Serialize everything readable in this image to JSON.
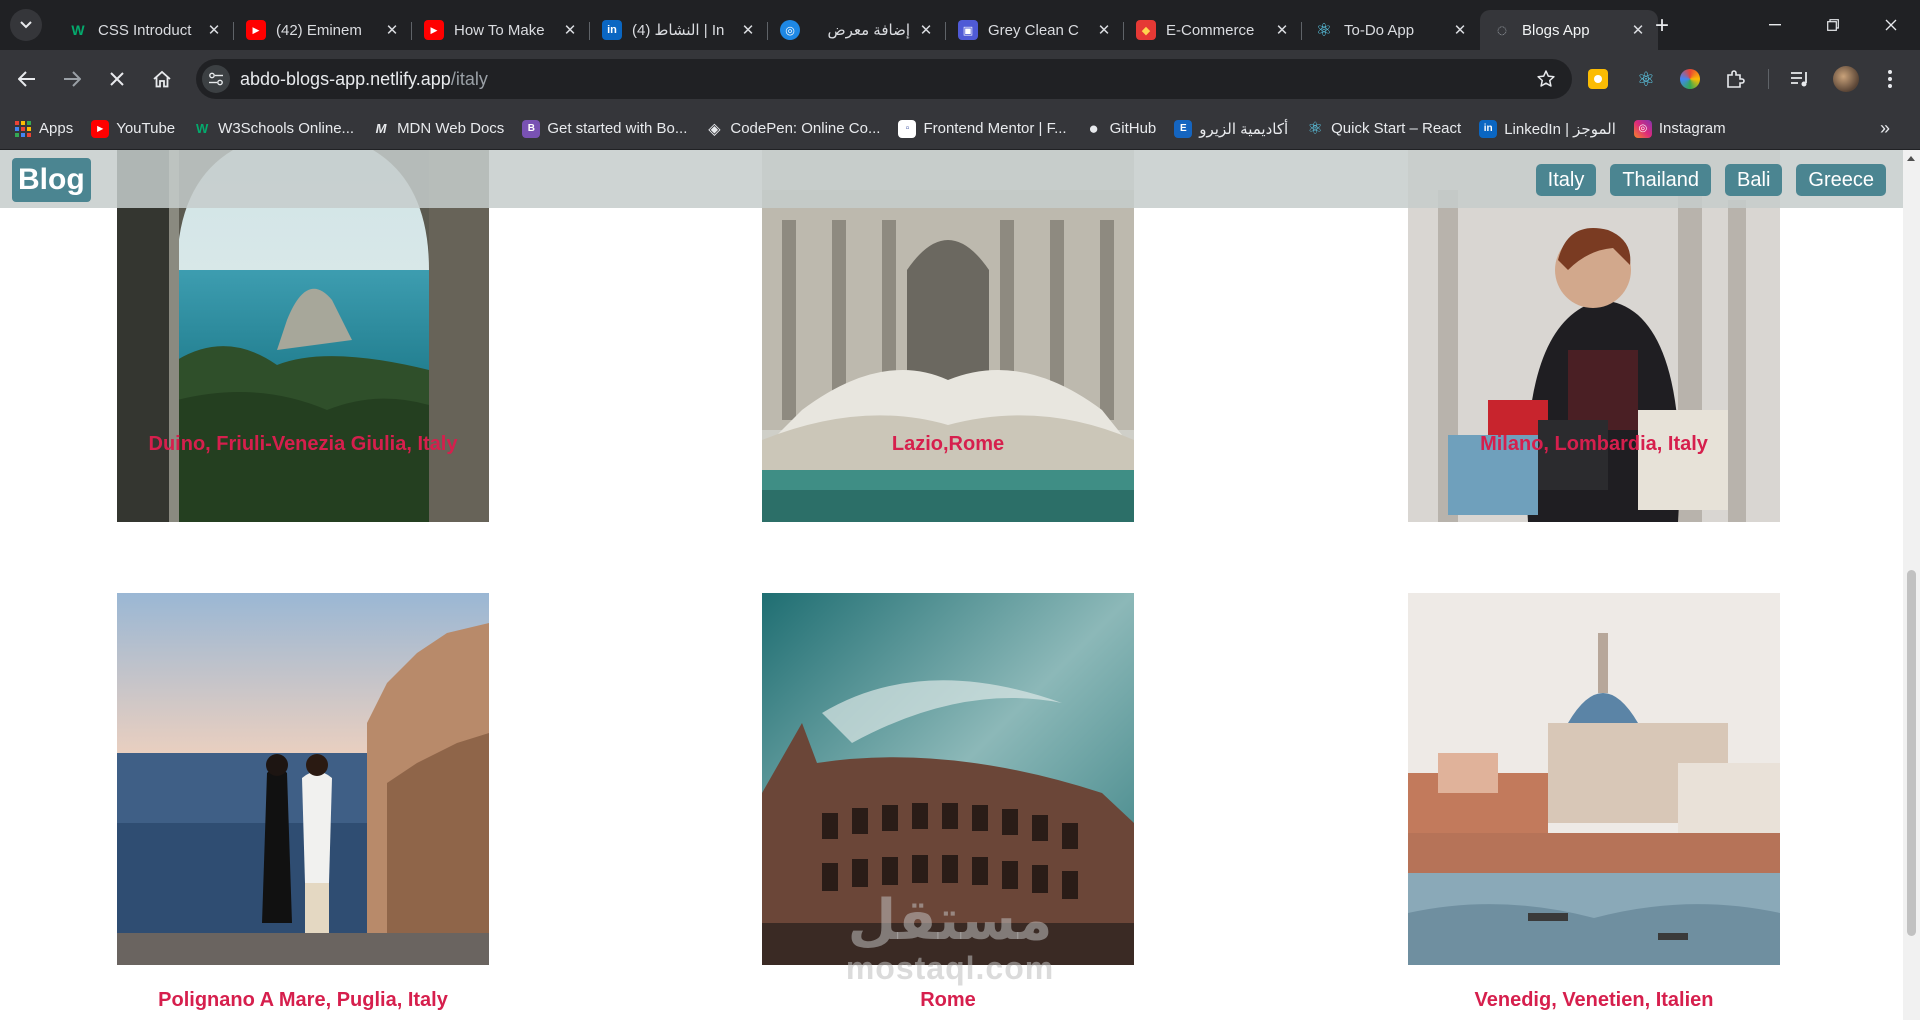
{
  "browser": {
    "tabs": [
      {
        "title": "CSS Introduct",
        "fav_text": "W",
        "fav_color": "#0f2027",
        "fav_fg": "#04aa6d"
      },
      {
        "title": "(42) Eminem",
        "fav_text": "▶",
        "fav_color": "#ff0000",
        "fav_fg": "#ffffff"
      },
      {
        "title": "How To Make",
        "fav_text": "▶",
        "fav_color": "#ff0000",
        "fav_fg": "#ffffff"
      },
      {
        "title": "(4) النشاط | In",
        "fav_text": "in",
        "fav_color": "#0a66c2",
        "fav_fg": "#ffffff"
      },
      {
        "title": "إضافة معرض",
        "fav_text": "◎",
        "fav_color": "#1e88e5",
        "fav_fg": "#ffffff"
      },
      {
        "title": "Grey Clean C",
        "fav_text": "▣",
        "fav_color": "#4f5ad6",
        "fav_fg": "#ffffff"
      },
      {
        "title": "E-Commerce",
        "fav_text": "◆",
        "fav_color": "#e53935",
        "fav_fg": "#ffd54f"
      },
      {
        "title": "To-Do App",
        "fav_text": "⚛",
        "fav_color": "transparent",
        "fav_fg": "#61dafb"
      },
      {
        "title": "Blogs App",
        "fav_text": "◌",
        "fav_color": "transparent",
        "fav_fg": "#9aa0a6"
      }
    ],
    "new_tab_symbol": "+",
    "url_domain": "abdo-blogs-app.netlify.app",
    "url_path": "/italy",
    "bookmarks": [
      {
        "label": "Apps",
        "fav_text": "⋮⋮",
        "fav_color": "transparent",
        "fav_fg": "#ea4335"
      },
      {
        "label": "YouTube",
        "fav_text": "▶",
        "fav_color": "#ff0000",
        "fav_fg": "#ffffff"
      },
      {
        "label": "W3Schools Online...",
        "fav_text": "W",
        "fav_color": "transparent",
        "fav_fg": "#04aa6d"
      },
      {
        "label": "MDN Web Docs",
        "fav_text": "M",
        "fav_color": "transparent",
        "fav_fg": "#e8eaed"
      },
      {
        "label": "Get started with Bo...",
        "fav_text": "B",
        "fav_color": "#7952b3",
        "fav_fg": "#ffffff"
      },
      {
        "label": "CodePen: Online Co...",
        "fav_text": "◈",
        "fav_color": "transparent",
        "fav_fg": "#e8eaed"
      },
      {
        "label": "Frontend Mentor | F...",
        "fav_text": "▫",
        "fav_color": "#ffffff",
        "fav_fg": "#3f54a3"
      },
      {
        "label": "GitHub",
        "fav_text": "●",
        "fav_color": "transparent",
        "fav_fg": "#e8eaed"
      },
      {
        "label": "أكاديمية الزيرو",
        "fav_text": "E",
        "fav_color": "#1565c0",
        "fav_fg": "#ffffff"
      },
      {
        "label": "Quick Start – React",
        "fav_text": "⚛",
        "fav_color": "transparent",
        "fav_fg": "#61dafb"
      },
      {
        "label": "LinkedIn | الموجز",
        "fav_text": "in",
        "fav_color": "#0a66c2",
        "fav_fg": "#ffffff"
      },
      {
        "label": "Instagram",
        "fav_text": "◎",
        "fav_color": "#d6249f",
        "fav_fg": "#ffffff"
      }
    ]
  },
  "page": {
    "logo": "Blog",
    "nav": [
      "Italy",
      "Thailand",
      "Bali",
      "Greece"
    ],
    "cards": [
      {
        "title": "Duino, Friuli-Venezia Giulia, Italy"
      },
      {
        "title": "Lazio,Rome"
      },
      {
        "title": "Milano, Lombardia, Italy"
      },
      {
        "title": "Polignano A Mare, Puglia, Italy"
      },
      {
        "title": "Rome"
      },
      {
        "title": "Venedig, Venetien, Italien"
      }
    ],
    "title_color": "#d61f4d",
    "accent_color": "#4b8591",
    "watermark_ar": "مستقل",
    "watermark_en": "mostaql.com"
  }
}
